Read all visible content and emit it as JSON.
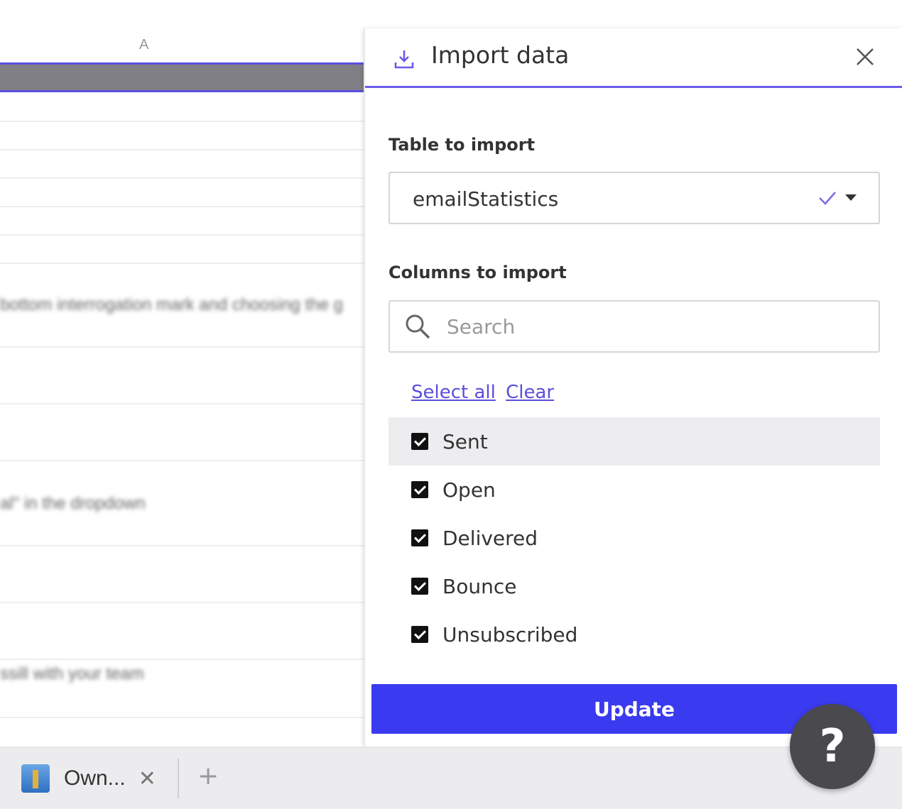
{
  "sheet": {
    "column_header": "A",
    "blurred_rows": [
      "bottom interrogation mark and choosing the g",
      "al\" in the dropdown",
      "ssill with your team"
    ]
  },
  "panel": {
    "title": "Import data",
    "icon": "import-icon",
    "close_icon": "close-icon",
    "table_label": "Table to import",
    "table_value": "emailStatistics",
    "columns_label": "Columns to import",
    "search_placeholder": "Search",
    "select_all_label": "Select all",
    "clear_label": "Clear",
    "columns": [
      {
        "name": "Sent",
        "checked": true
      },
      {
        "name": "Open",
        "checked": true
      },
      {
        "name": "Delivered",
        "checked": true
      },
      {
        "name": "Bounce",
        "checked": true
      },
      {
        "name": "Unsubscribed",
        "checked": true
      }
    ],
    "update_label": "Update",
    "accent_color": "#6a5ce8",
    "button_color": "#3a3af0"
  },
  "tabbar": {
    "tab_label": "Own...",
    "add_label": "+"
  },
  "help": {
    "label": "?"
  }
}
